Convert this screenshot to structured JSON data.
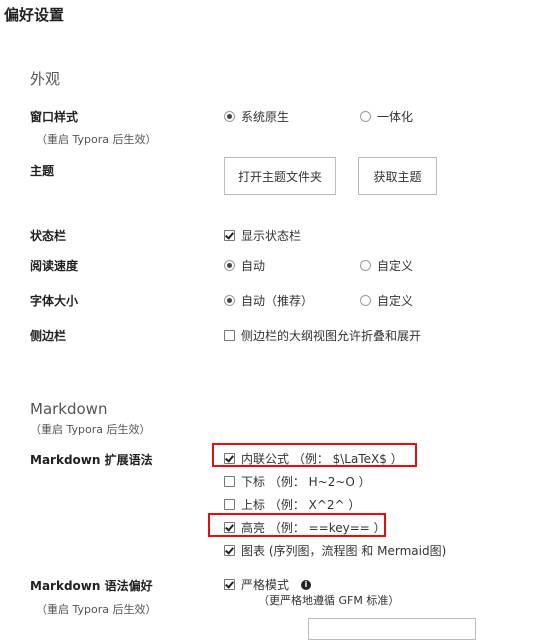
{
  "page_title": "偏好设置",
  "appearance": {
    "section_title": "外观",
    "window_style": {
      "label": "窗口样式",
      "note": "（重启 Typora 后生效）",
      "options": [
        "系统原生",
        "一体化"
      ],
      "selected": "系统原生"
    },
    "theme": {
      "label": "主题",
      "open_folder_button": "打开主题文件夹",
      "get_themes_button": "获取主题"
    },
    "status_bar": {
      "label": "状态栏",
      "option": "显示状态栏",
      "checked": true
    },
    "reading_speed": {
      "label": "阅读速度",
      "options": [
        "自动",
        "自定义"
      ],
      "selected": "自动"
    },
    "font_size": {
      "label": "字体大小",
      "options": [
        "自动（推荐）",
        "自定义"
      ],
      "selected": "自动（推荐）"
    },
    "sidebar": {
      "label": "侧边栏",
      "option": "侧边栏的大纲视图允许折叠和展开",
      "checked": false
    }
  },
  "markdown": {
    "section_title": "Markdown",
    "section_note": "（重启 Typora 后生效）",
    "extended_syntax": {
      "label": "Markdown 扩展语法",
      "options": [
        {
          "text": "内联公式 （例： $\\LaTeX$ ）",
          "checked": true,
          "highlighted": true
        },
        {
          "text": "下标 （例： H~2~O ）",
          "checked": false,
          "highlighted": false
        },
        {
          "text": "上标 （例： X^2^ ）",
          "checked": false,
          "highlighted": false
        },
        {
          "text": "高亮 （例： ==key== ）",
          "checked": true,
          "highlighted": true
        },
        {
          "text": "图表 (序列图，流程图 和 Mermaid图)",
          "checked": true,
          "highlighted": false
        }
      ]
    },
    "syntax_preference": {
      "label": "Markdown 语法偏好",
      "note": "（重启 Typora 后生效）",
      "option": "严格模式",
      "option_detail": "（更严格地遵循 GFM 标准）",
      "checked": true
    }
  },
  "colors": {
    "highlight_border": "#e01010",
    "text": "#333333"
  },
  "icons": {
    "info": "info-icon"
  }
}
